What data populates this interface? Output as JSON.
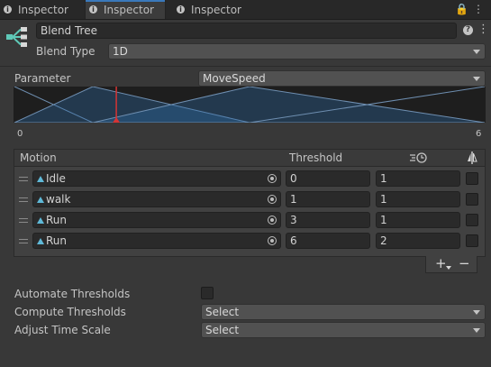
{
  "tabs": [
    {
      "label": "Inspector",
      "active": false
    },
    {
      "label": "Inspector",
      "active": true
    },
    {
      "label": "Inspector",
      "active": false
    }
  ],
  "tabbar_buttons": {
    "lock": "🔒",
    "menu": "⋮"
  },
  "header": {
    "name": "Blend Tree",
    "blend_type_label": "Blend Type",
    "blend_type_value": "1D",
    "help_glyph": "?",
    "settings_glyph": "⋮"
  },
  "parameter": {
    "label": "Parameter",
    "value": "MoveSpeed",
    "min_label": "0",
    "max_label": "6",
    "min": 0,
    "max": 6,
    "current": 1.3
  },
  "table": {
    "headers": {
      "motion": "Motion",
      "threshold": "Threshold"
    },
    "rows": [
      {
        "motion": "Idle",
        "threshold": "0",
        "time_scale": "1",
        "mirror": false
      },
      {
        "motion": "walk",
        "threshold": "1",
        "time_scale": "1",
        "mirror": false
      },
      {
        "motion": "Run",
        "threshold": "3",
        "time_scale": "1",
        "mirror": false
      },
      {
        "motion": "Run",
        "threshold": "6",
        "time_scale": "2",
        "mirror": false
      }
    ],
    "add_glyph": "+",
    "remove_glyph": "−"
  },
  "options": {
    "automate_label": "Automate Thresholds",
    "automate_checked": false,
    "compute_label": "Compute Thresholds",
    "compute_value": "Select",
    "adjust_label": "Adjust Time Scale",
    "adjust_value": "Select"
  },
  "colors": {
    "accent": "#3a79bb",
    "blend_fill": "#2e6eaa",
    "marker": "#d43434"
  },
  "icons": {
    "tab": "info-icon",
    "header": "blend-tree-icon",
    "motion": "animation-clip-icon",
    "time_scale": "speed-clock-icon",
    "mirror": "mirror-icon"
  }
}
